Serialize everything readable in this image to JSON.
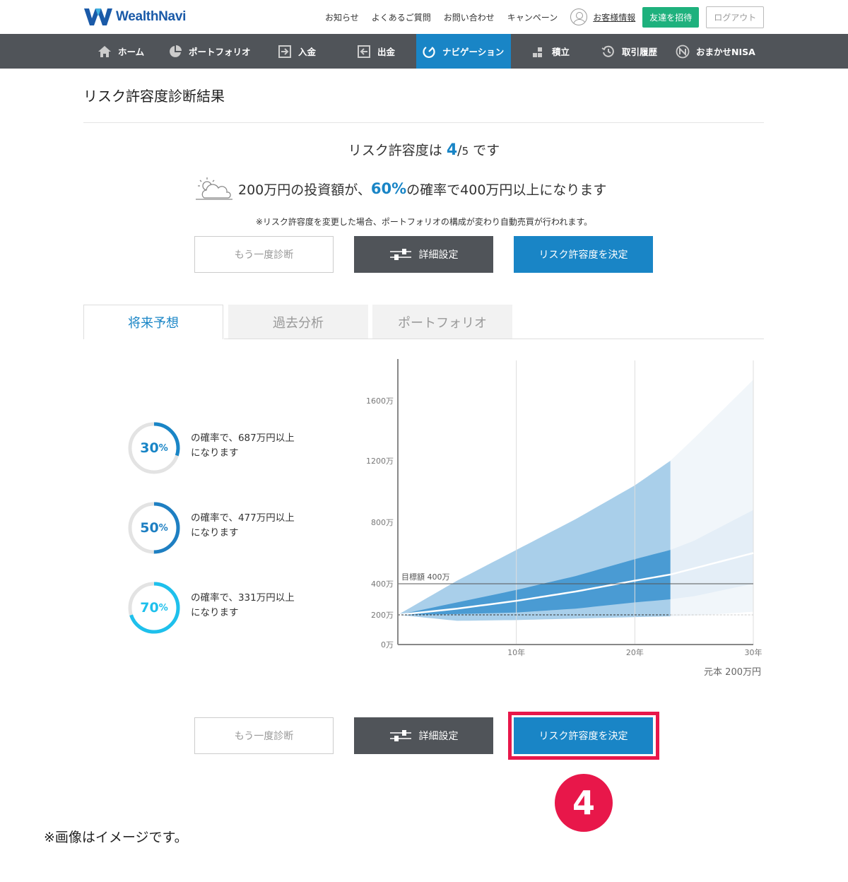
{
  "brand": {
    "name": "WealthNavi",
    "color": "#1a5aa8"
  },
  "topbar": {
    "links": [
      "お知らせ",
      "よくあるご質問",
      "お問い合わせ",
      "キャンペーン"
    ],
    "account_label": "お客様情報",
    "invite_label": "友達を招待",
    "logout_label": "ログアウト"
  },
  "nav": {
    "items": [
      {
        "label": "ホーム",
        "icon": "home-icon"
      },
      {
        "label": "ポートフォリオ",
        "icon": "pie-chart-icon"
      },
      {
        "label": "入金",
        "icon": "deposit-icon"
      },
      {
        "label": "出金",
        "icon": "withdraw-icon"
      },
      {
        "label": "ナビゲーション",
        "icon": "navigation-icon",
        "active": true
      },
      {
        "label": "積立",
        "icon": "blocks-icon"
      },
      {
        "label": "取引履歴",
        "icon": "history-icon"
      },
      {
        "label": "おまかせNISA",
        "icon": "nisa-icon"
      }
    ]
  },
  "page": {
    "title": "リスク許容度診断結果",
    "summary": {
      "prefix": "リスク許容度は",
      "level": "4",
      "slash": "/",
      "max": "5",
      "suffix": "です",
      "forecast_prefix": "200万円の投資額が、",
      "forecast_pct": "60%",
      "forecast_suffix": "の確率で400万円以上になります",
      "note": "※リスク許容度を変更した場合、ポートフォリオの構成が変わり自動売買が行われます。"
    },
    "buttons": {
      "retry": "もう一度診断",
      "detail": "詳細設定",
      "decide": "リスク許容度を決定"
    },
    "tabs": [
      "将来予想",
      "過去分析",
      "ポートフォリオ"
    ],
    "probabilities": [
      {
        "pct": "30",
        "unit": "%",
        "line1": "の確率で、687万円以上",
        "line2": "になります",
        "fraction": 0.3,
        "color": "#1985c6"
      },
      {
        "pct": "50",
        "unit": "%",
        "line1": "の確率で、477万円以上",
        "line2": "になります",
        "fraction": 0.5,
        "color": "#1e7fc2"
      },
      {
        "pct": "70",
        "unit": "%",
        "line1": "の確率で、331万円以上",
        "line2": "になります",
        "fraction": 0.7,
        "color": "#1ec0ec"
      }
    ],
    "principal_note": "元本 200万円",
    "step_badge": "4",
    "disclaimer": "※画像はイメージです。"
  },
  "chart_data": {
    "type": "area",
    "y_ticks": [
      "0万",
      "200万",
      "400万",
      "800万",
      "1200万",
      "1600万"
    ],
    "y_tick_values": [
      0,
      200,
      400,
      800,
      1200,
      1600
    ],
    "x_ticks": [
      "10年",
      "20年",
      "30年"
    ],
    "x_tick_values": [
      10,
      20,
      30
    ],
    "xlim": [
      0,
      30
    ],
    "ylim": [
      0,
      1900
    ],
    "target_label": "目標額 400万",
    "target_value": 400,
    "principal_value": 200,
    "highlight_until_year": 23,
    "colors": {
      "outer": "#a9cfea",
      "inner": "#4a9bd3",
      "median": "#ffffff"
    },
    "x": [
      0,
      5,
      10,
      15,
      20,
      23,
      25,
      30
    ],
    "series": [
      {
        "values": [
          200,
          420,
          620,
          820,
          1040,
          1200,
          1350,
          1740
        ]
      },
      {
        "values": [
          200,
          280,
          360,
          450,
          560,
          620,
          680,
          880
        ]
      },
      {
        "values": [
          200,
          240,
          290,
          350,
          420,
          460,
          500,
          600
        ]
      },
      {
        "values": [
          200,
          205,
          215,
          240,
          280,
          300,
          320,
          400
        ]
      },
      {
        "values": [
          200,
          160,
          165,
          175,
          185,
          190,
          195,
          220
        ]
      }
    ]
  }
}
